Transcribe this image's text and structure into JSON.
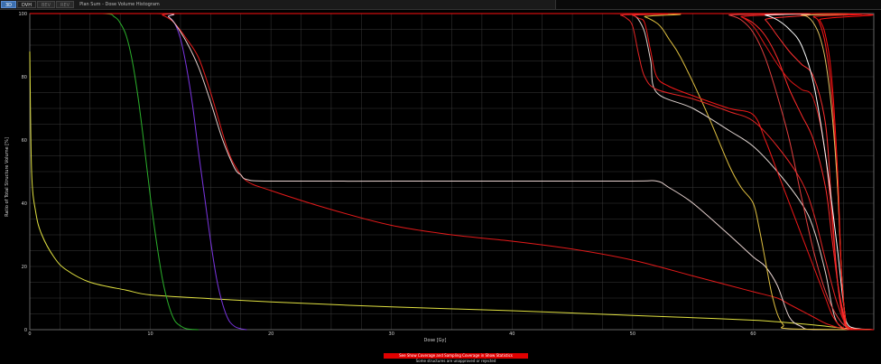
{
  "toolbar": {
    "tabs": [
      {
        "label": "3D",
        "state": "active"
      },
      {
        "label": "DVH",
        "state": "selected"
      },
      {
        "label": "BEV",
        "state": "inactive"
      },
      {
        "label": "REV",
        "state": "inactive"
      }
    ],
    "window_title": "Plan Sum - Dose Volume Histogram"
  },
  "footer": {
    "warning": "See Show Coverage and Sampling Coverage in Show Statistics",
    "note": "Some structures are unapproved or rejected"
  },
  "colors": {
    "background": "#000000",
    "grid": "#3a3a3a",
    "axis_text": "#cfcfcf",
    "warning_bg": "#e00000"
  },
  "chart_data": {
    "type": "line",
    "xlabel": "Dose [Gy]",
    "ylabel": "Ratio of Total Structure Volume [%]",
    "xlim": [
      0,
      70
    ],
    "ylim": [
      0,
      100
    ],
    "x_ticks": [
      0,
      10,
      20,
      30,
      40,
      50,
      60
    ],
    "y_ticks": [
      0,
      20,
      40,
      60,
      80,
      100
    ],
    "grid": true,
    "series": [
      {
        "color": "#e0e040",
        "x": [
          0,
          0.15,
          0.5,
          1,
          2,
          3,
          5,
          8,
          10,
          15,
          20,
          30,
          40,
          50,
          55,
          60,
          62,
          65,
          68,
          70
        ],
        "y": [
          88,
          50,
          37,
          30,
          23,
          19,
          15,
          12.5,
          11,
          9.8,
          8.8,
          7.2,
          6,
          4.5,
          3.8,
          3,
          2.5,
          1.5,
          0.3,
          0
        ]
      },
      {
        "color": "#2bb02b",
        "x": [
          0,
          6,
          7,
          7.5,
          8,
          8.5,
          9,
          9.5,
          10,
          10.5,
          11,
          11.5,
          12,
          12.5,
          13,
          14
        ],
        "y": [
          100,
          100,
          99,
          97,
          93,
          85,
          73,
          58,
          42,
          28,
          16,
          8,
          3,
          1.2,
          0.3,
          0
        ]
      },
      {
        "color": "#7a35e0",
        "x": [
          0,
          11,
          11.5,
          12,
          12.5,
          13,
          13.5,
          14,
          14.5,
          15,
          15.5,
          16,
          16.5,
          17,
          17.5,
          18
        ],
        "y": [
          100,
          100,
          99,
          97,
          92,
          83,
          71,
          56,
          42,
          28,
          16,
          8,
          3,
          1,
          0.3,
          0
        ]
      },
      {
        "color": "#e31a1a",
        "x": [
          0,
          10.5,
          11,
          11.5,
          12,
          13,
          14,
          15,
          16,
          16.5,
          17,
          18,
          20,
          25,
          30,
          35,
          40,
          45,
          50,
          55,
          58,
          60,
          62,
          63,
          65,
          66,
          67,
          67.5,
          68,
          68.5,
          69,
          70
        ],
        "y": [
          100,
          100,
          99.5,
          98.5,
          97,
          92,
          86,
          75,
          62,
          56,
          52,
          47,
          44,
          38,
          33,
          30,
          28,
          25.5,
          22,
          17,
          14,
          12,
          10,
          8,
          4,
          2,
          0.7,
          0.2,
          0,
          0,
          0,
          0
        ]
      },
      {
        "color": "#e7d2cf",
        "x": [
          0,
          11,
          11.5,
          12,
          13,
          14,
          15,
          16,
          17,
          17.5,
          18,
          20,
          30,
          40,
          50,
          52,
          53,
          55,
          58,
          60,
          61,
          62,
          63,
          64,
          65,
          70
        ],
        "y": [
          100,
          100,
          99,
          97,
          91,
          83,
          72,
          60,
          51,
          49,
          47.5,
          47,
          47,
          47,
          47,
          47,
          45,
          40,
          30,
          23,
          20,
          14,
          4,
          1,
          0,
          0
        ]
      },
      {
        "color": "#e0c040",
        "x": [
          0,
          50,
          51,
          52,
          52.5,
          53,
          54,
          56,
          58,
          59,
          60,
          60.5,
          61,
          61.5,
          62,
          62.5,
          63,
          70
        ],
        "y": [
          100,
          100,
          99,
          97,
          95,
          92,
          86,
          70,
          52,
          45,
          40,
          32,
          22,
          12,
          5,
          1.5,
          0.3,
          0
        ]
      },
      {
        "color": "#e0d4d0",
        "x": [
          0,
          49,
          50,
          50.5,
          51,
          51.5,
          52,
          55,
          58,
          60,
          62,
          64,
          65,
          66,
          66.5,
          67,
          68,
          70
        ],
        "y": [
          100,
          100,
          99.5,
          98,
          94,
          85,
          75,
          70,
          63,
          58,
          50,
          40,
          32,
          18,
          8,
          2,
          0,
          0
        ]
      },
      {
        "color": "#f01818",
        "x": [
          0,
          49,
          50,
          50.5,
          51,
          51.5,
          52,
          53,
          55,
          58,
          60,
          61,
          62,
          63,
          64,
          65,
          66,
          66.5,
          67,
          67.5,
          68,
          70
        ],
        "y": [
          100,
          100,
          99.5,
          98.5,
          97,
          88,
          80,
          77,
          74,
          70,
          68,
          60,
          50,
          40,
          30,
          20,
          10,
          5,
          2,
          0.5,
          0,
          0
        ]
      },
      {
        "color": "#e62525",
        "x": [
          0,
          48,
          49,
          49.5,
          50,
          50.5,
          51,
          52,
          55,
          58,
          60,
          62,
          64,
          65,
          66,
          67,
          68,
          70
        ],
        "y": [
          100,
          100,
          99.5,
          98.5,
          96,
          87,
          80,
          76,
          73,
          69,
          66,
          58,
          47,
          37,
          22,
          8,
          0.5,
          0
        ]
      },
      {
        "color": "#ff2a2a",
        "x": [
          0,
          58,
          59,
          60,
          61,
          62,
          63,
          64,
          65,
          66,
          66.5,
          67,
          67.5,
          68,
          70
        ],
        "y": [
          100,
          100,
          99,
          97,
          93,
          86,
          76,
          68,
          60,
          45,
          30,
          15,
          5,
          0.5,
          0
        ]
      },
      {
        "color": "#d81515",
        "x": [
          0,
          58,
          59,
          60,
          61,
          62,
          63,
          64,
          65,
          66,
          67,
          67.5,
          68,
          70
        ],
        "y": [
          100,
          100,
          99,
          96,
          90,
          84,
          79,
          76,
          73,
          55,
          15,
          3,
          0.3,
          0
        ]
      },
      {
        "color": "#e44040",
        "x": [
          0,
          57,
          58,
          59,
          60,
          61,
          62,
          63,
          64,
          65,
          66,
          67,
          68,
          70
        ],
        "y": [
          100,
          100,
          99.5,
          98,
          94,
          86,
          74,
          60,
          42,
          25,
          12,
          4,
          0.5,
          0
        ]
      },
      {
        "color": "#ff3030",
        "x": [
          0,
          60,
          61,
          62,
          63,
          64,
          65,
          66,
          66.5,
          67,
          67.5,
          68,
          70
        ],
        "y": [
          100,
          100,
          98,
          93,
          88,
          84,
          80,
          65,
          40,
          15,
          4,
          0.3,
          0
        ]
      },
      {
        "color": "#ffffff",
        "x": [
          0,
          60,
          61,
          62,
          63,
          64,
          65,
          66,
          67,
          67.5,
          68,
          70
        ],
        "y": [
          100,
          100,
          99.5,
          98,
          95,
          90,
          78,
          55,
          25,
          8,
          1,
          0
        ]
      },
      {
        "color": "#f51c1c",
        "x": [
          0,
          64,
          65,
          65.5,
          66,
          66.5,
          67,
          67.3,
          67.6,
          68,
          70
        ],
        "y": [
          100,
          100,
          99,
          97,
          90,
          75,
          45,
          20,
          5,
          0.3,
          0
        ]
      },
      {
        "color": "#e0c060",
        "x": [
          0,
          63,
          64,
          64.5,
          65,
          65.5,
          66,
          66.5,
          67,
          67.3,
          67.6,
          68,
          70
        ],
        "y": [
          100,
          100,
          99.5,
          99,
          97,
          93,
          85,
          70,
          45,
          20,
          5,
          0.5,
          0
        ]
      },
      {
        "color": "#ff1010",
        "x": [
          0,
          65,
          65.5,
          66,
          66.5,
          67,
          67.3,
          67.6,
          68,
          70
        ],
        "y": [
          100,
          100,
          98,
          93,
          80,
          50,
          20,
          5,
          0.5,
          0
        ]
      }
    ]
  }
}
